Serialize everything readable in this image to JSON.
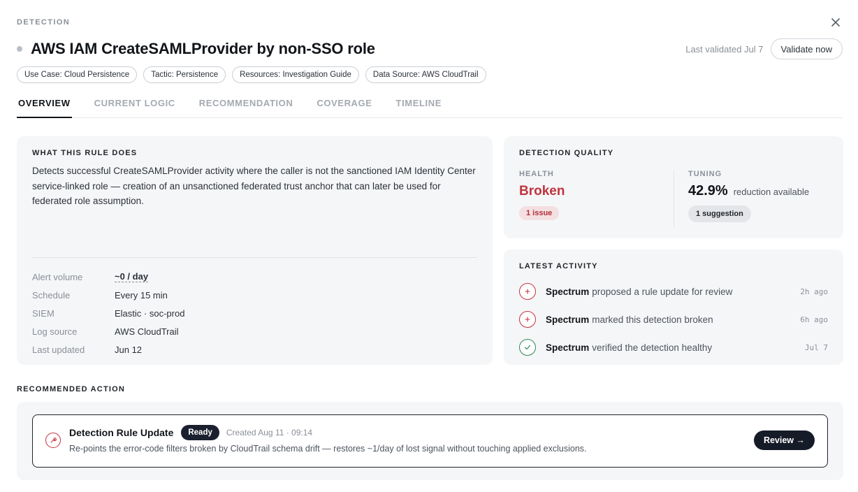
{
  "header": {
    "eyebrow": "DETECTION",
    "title": "AWS IAM CreateSAMLProvider by non-SSO role",
    "last_validated": "Last validated Jul 7",
    "validate_label": "Validate now",
    "close_icon": "close-icon"
  },
  "tags": [
    "Use Case: Cloud Persistence",
    "Tactic: Persistence",
    "Resources: Investigation Guide",
    "Data Source: AWS CloudTrail"
  ],
  "tabs": [
    {
      "label": "OVERVIEW",
      "active": true
    },
    {
      "label": "CURRENT LOGIC",
      "active": false
    },
    {
      "label": "RECOMMENDATION",
      "active": false
    },
    {
      "label": "COVERAGE",
      "active": false
    },
    {
      "label": "TIMELINE",
      "active": false
    }
  ],
  "rule": {
    "title": "WHAT THIS RULE DOES",
    "description": "Detects successful CreateSAMLProvider activity where the caller is not the sanctioned IAM Identity Center service-linked role — creation of an unsanctioned federated trust anchor that can later be used for federated role assumption.",
    "meta": [
      {
        "key": "Alert volume",
        "value": "~0 / day"
      },
      {
        "key": "Schedule",
        "value": "Every 15 min"
      },
      {
        "key": "SIEM",
        "value": "Elastic · soc-prod"
      },
      {
        "key": "Log source",
        "value": "AWS CloudTrail"
      },
      {
        "key": "Last updated",
        "value": "Jun 12"
      }
    ]
  },
  "quality": {
    "title": "DETECTION QUALITY",
    "health_label": "HEALTH",
    "health_value": "Broken",
    "health_pill": "1 issue",
    "tuning_label": "TUNING",
    "tuning_value": "42.9%",
    "tuning_desc": "reduction available",
    "tuning_pill": "1 suggestion",
    "colors": {
      "broken": "#c0343d",
      "healthy": "#2b8a57"
    }
  },
  "activity": {
    "title": "LATEST ACTIVITY",
    "items": [
      {
        "actor": "Spectrum",
        "text": "proposed a rule update for review",
        "time": "2h ago",
        "icon": "plus-icon"
      },
      {
        "actor": "Spectrum",
        "text": "marked this detection broken",
        "time": "6h ago",
        "icon": "plus-icon"
      },
      {
        "actor": "Spectrum",
        "text": "verified the detection healthy",
        "time": "Jul 7",
        "icon": "check-icon"
      }
    ]
  },
  "recommended": {
    "section_label": "RECOMMENDED ACTION",
    "title": "Detection Rule Update",
    "badge": "Ready",
    "created": "Created Aug 11 · 09:14",
    "description": "Re-points the error-code filters broken by CloudTrail schema drift — restores ~1/day of lost signal without touching applied exclusions.",
    "review_label": "Review →",
    "icon": "wrench-icon"
  }
}
